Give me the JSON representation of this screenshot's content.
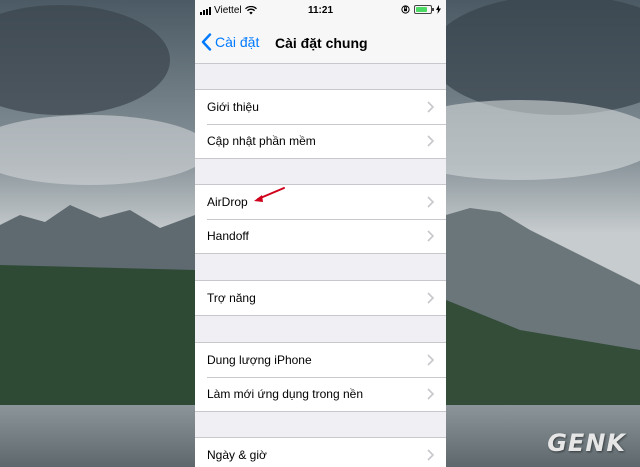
{
  "status_bar": {
    "carrier": "Viettel",
    "time": "11:21",
    "battery_level": 0.75,
    "battery_color": "#4cd964"
  },
  "nav": {
    "back_label": "Cài đặt",
    "title": "Cài đặt chung"
  },
  "settings_groups": [
    {
      "items": [
        "Giới thiệu",
        "Cập nhật phần mềm"
      ]
    },
    {
      "items": [
        "AirDrop",
        "Handoff"
      ]
    },
    {
      "items": [
        "Trợ năng"
      ]
    },
    {
      "items": [
        "Dung lượng iPhone",
        "Làm mới ứng dụng trong nền"
      ]
    },
    {
      "items": [
        "Ngày & giờ"
      ]
    }
  ],
  "annotation": {
    "target": "AirDrop",
    "color": "#d0021b"
  },
  "watermark": "GENK",
  "colors": {
    "accent": "#007aff",
    "group_bg": "#efeff4",
    "separator": "#c8c7cc"
  }
}
